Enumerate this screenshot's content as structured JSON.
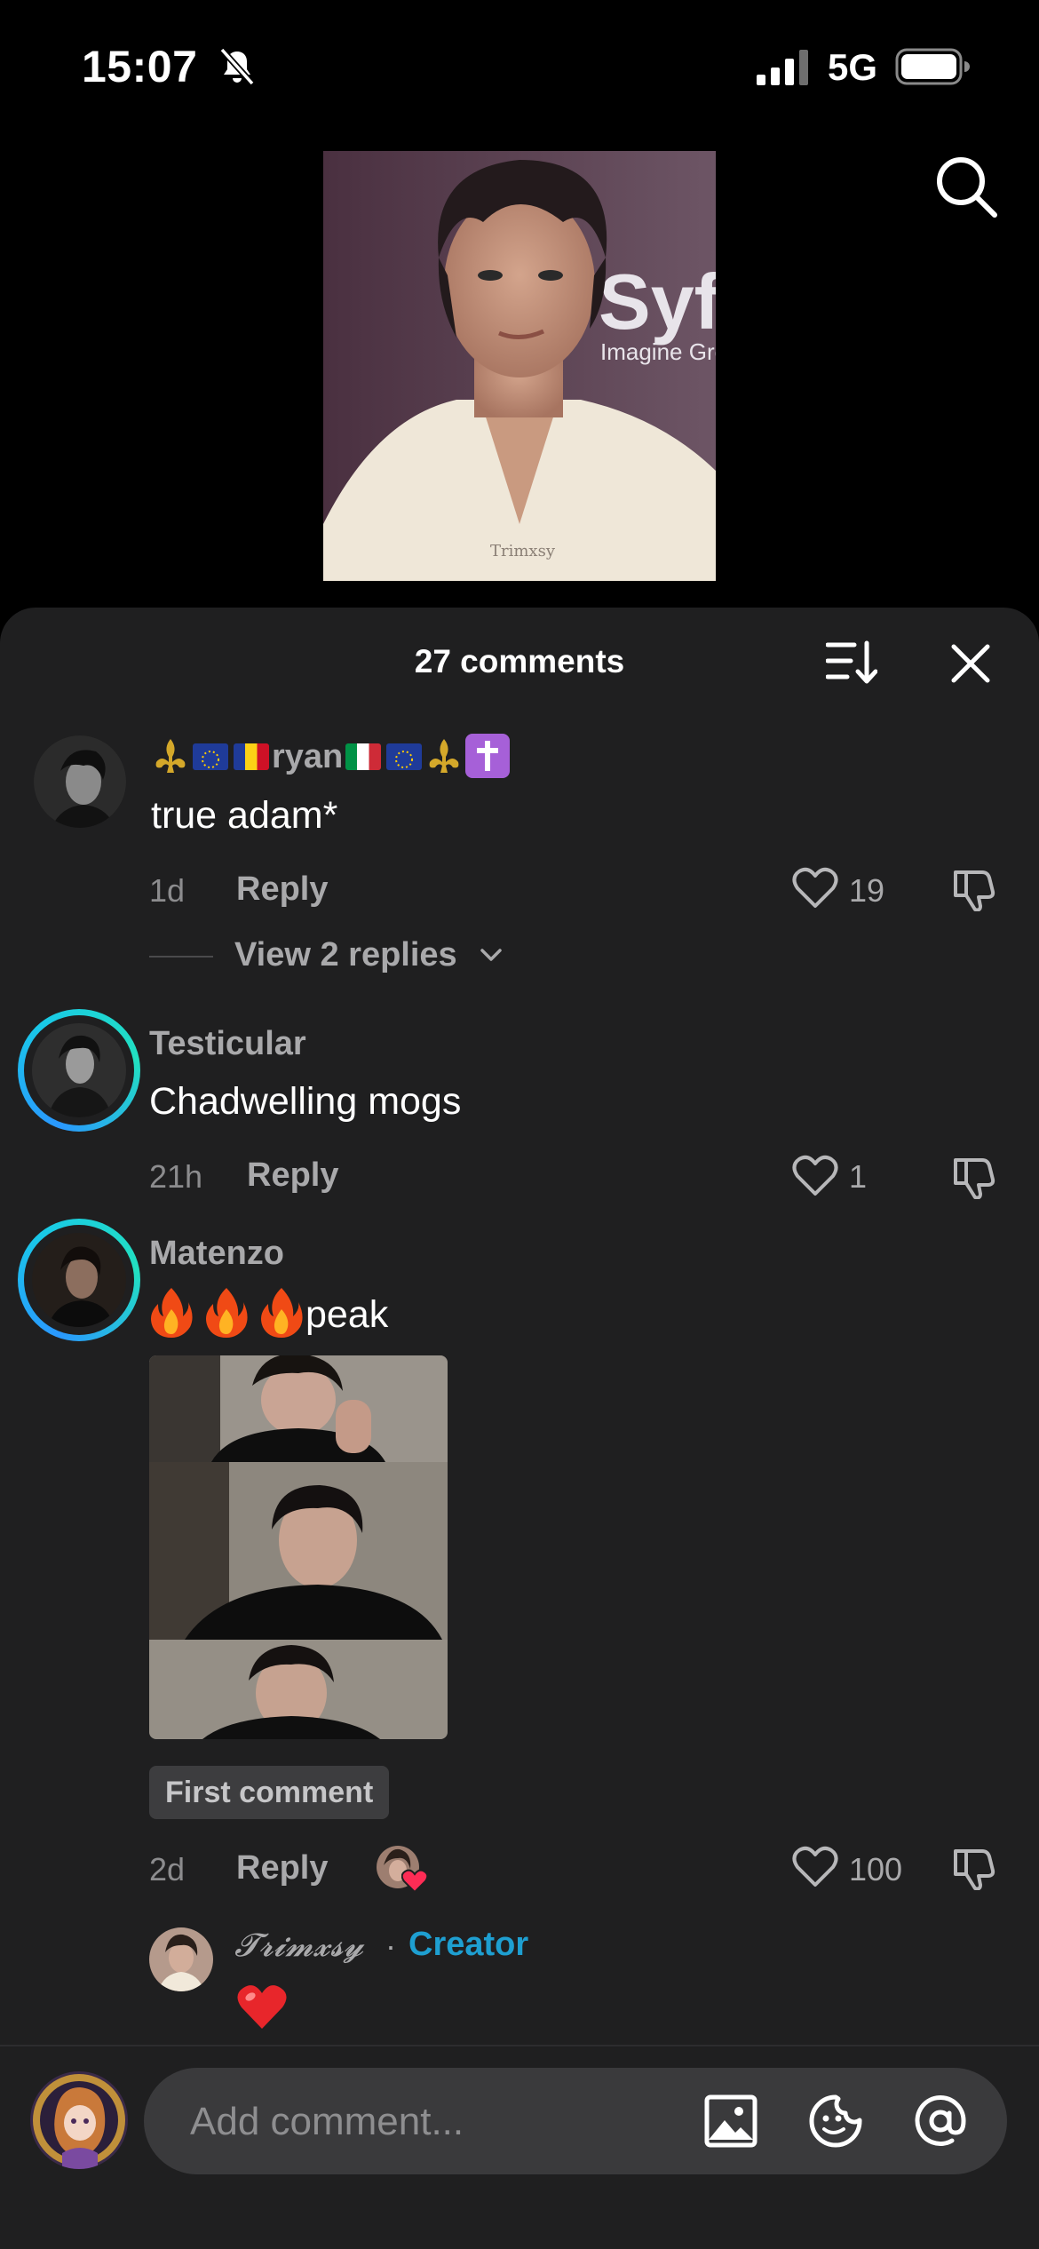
{
  "status_bar": {
    "time": "15:07",
    "network": "5G",
    "icons": [
      "bell-slash-icon",
      "signal-icon",
      "battery-icon"
    ]
  },
  "header": {
    "comment_count": "27 comments",
    "thumb_watermark": "Trimxsy",
    "icons": [
      "search-icon",
      "sort-icon",
      "close-icon"
    ]
  },
  "comments": [
    {
      "username_text": "ryan",
      "username_emoji": [
        "fleur-de-lis",
        "eu-flag",
        "romania-flag",
        "ryan",
        "italy-flag",
        "eu-flag",
        "fleur-de-lis",
        "latin-cross"
      ],
      "text": "true adam*",
      "age": "1d",
      "reply_label": "Reply",
      "likes": "19",
      "view_replies": "View 2 replies"
    },
    {
      "username": "Testicular",
      "text": "Chadwelling mogs",
      "age": "21h",
      "reply_label": "Reply",
      "likes": "1"
    },
    {
      "username": "Matenzo",
      "text": "peak",
      "badge": "First comment",
      "age": "2d",
      "reply_label": "Reply",
      "likes": "100",
      "creator_reply": {
        "name": "𝓣𝓻𝓲𝓶𝔁𝓼𝔂",
        "separator": "·",
        "role": "Creator",
        "reaction": "heart"
      }
    }
  ],
  "composer": {
    "placeholder": "Add comment...",
    "icons": [
      "image-icon",
      "sticker-icon",
      "mention-icon"
    ]
  },
  "colors": {
    "sheet_bg": "#1f1f20",
    "creator_accent": "#1e9fd1",
    "ring_gradient": [
      "#2a98ff",
      "#22e0c0"
    ]
  }
}
